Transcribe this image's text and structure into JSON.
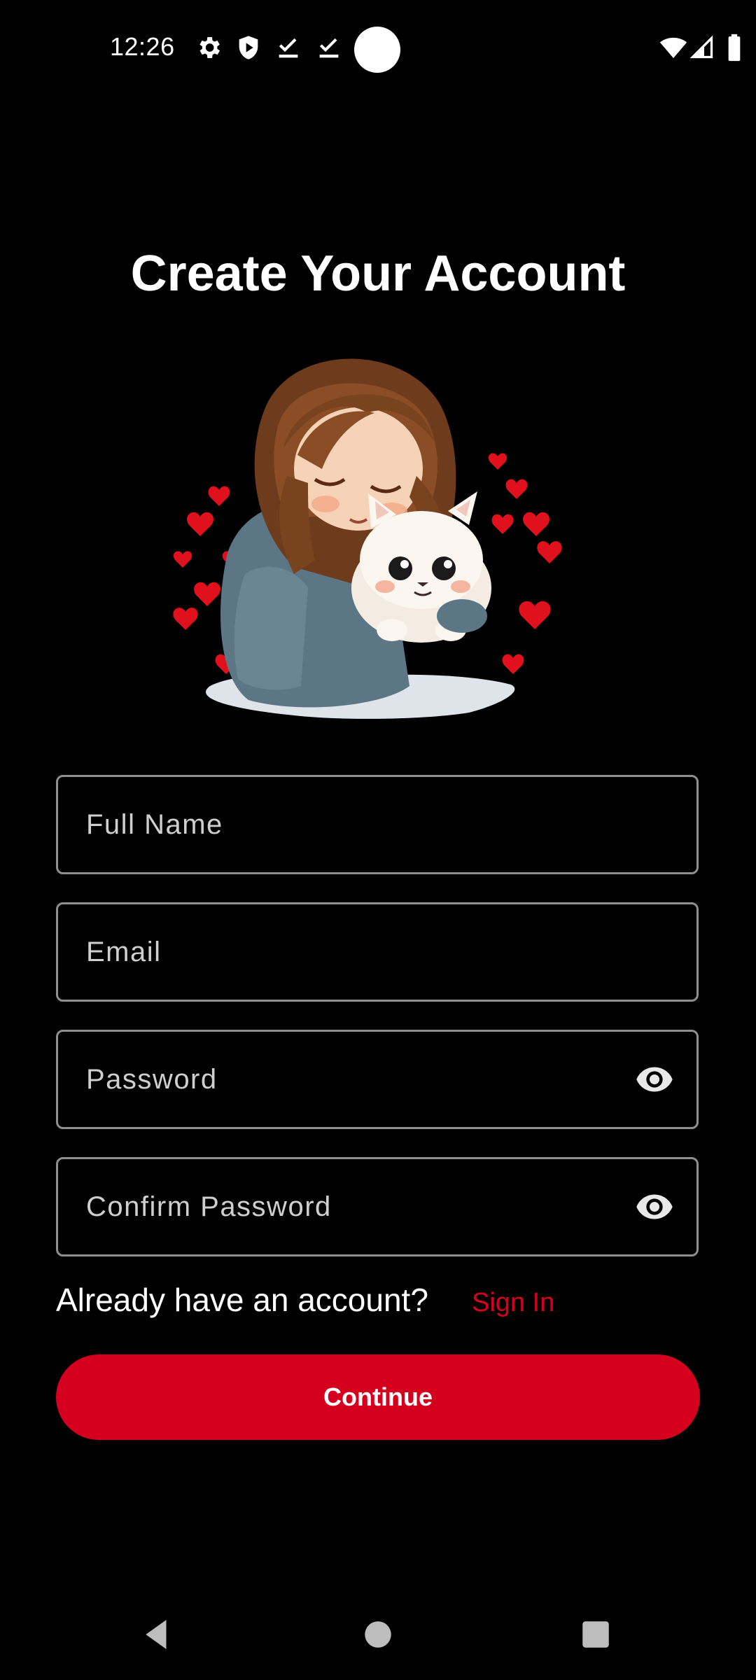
{
  "status_bar": {
    "time": "12:26",
    "left_icons": [
      "settings-icon",
      "shield-icon",
      "download-done-icon",
      "download-done-icon"
    ],
    "right_icons": [
      "wifi-icon",
      "cell-signal-icon",
      "battery-icon"
    ]
  },
  "page": {
    "title": "Create Your Account"
  },
  "form": {
    "full_name_placeholder": "Full Name",
    "email_placeholder": "Email",
    "password_placeholder": "Password",
    "confirm_password_placeholder": "Confirm Password"
  },
  "signin": {
    "prompt": "Already have an account?",
    "link": "Sign In"
  },
  "continue_label": "Continue",
  "nav_bar": {
    "buttons": [
      "back-icon",
      "home-icon",
      "recents-icon"
    ]
  },
  "colors": {
    "background": "#000000",
    "accent": "#d4001e",
    "field_border": "#8f8f8f",
    "placeholder": "#cfcfcf"
  }
}
